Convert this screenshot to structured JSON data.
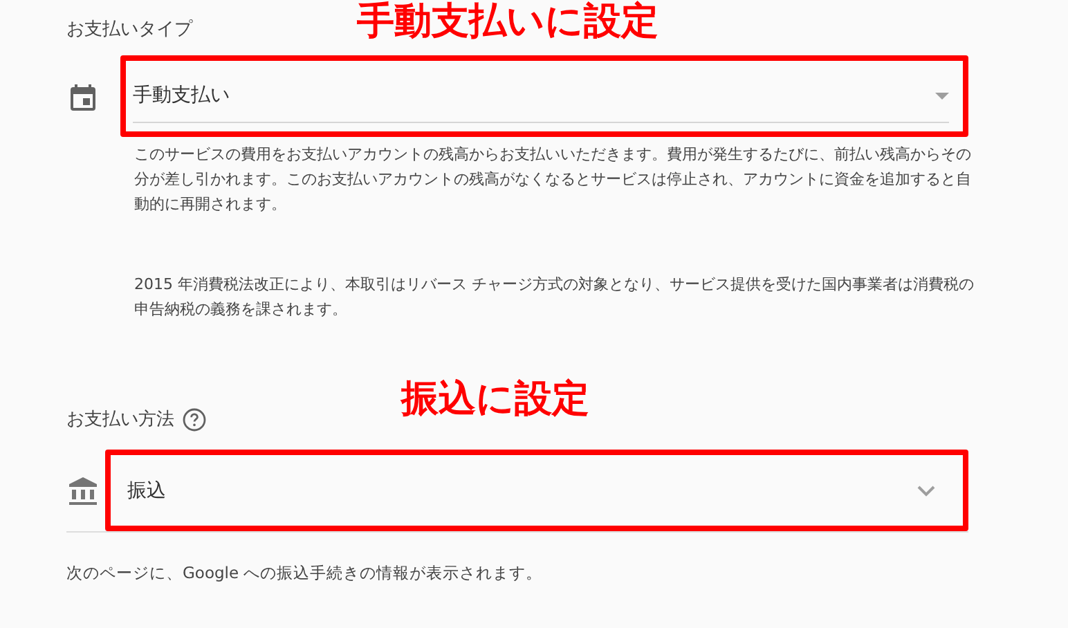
{
  "sections": [
    {
      "label": "お支払いタイプ",
      "help": false,
      "value": "手動支払い",
      "annotation": "手動支払いに設定",
      "notes": [
        "このサービスの費用をお支払いアカウントの残高からお支払いいただきます。費用が発生するたびに、前払い残高からその分が差し引かれます。このお支払いアカウントの残高がなくなるとサービスは停止され、アカウントに資金を追加すると自動的に再開されます。",
        "2015 年消費税法改正により、本取引はリバース チャージ方式の対象となり、サービス提供を受けた国内事業者は消費税の申告納税の義務を課されます。"
      ]
    },
    {
      "label": "お支払い方法",
      "help": true,
      "value": "振込",
      "annotation": "振込に設定"
    }
  ],
  "footer": "次のページに、Google への振込手続きの情報が表示されます。"
}
